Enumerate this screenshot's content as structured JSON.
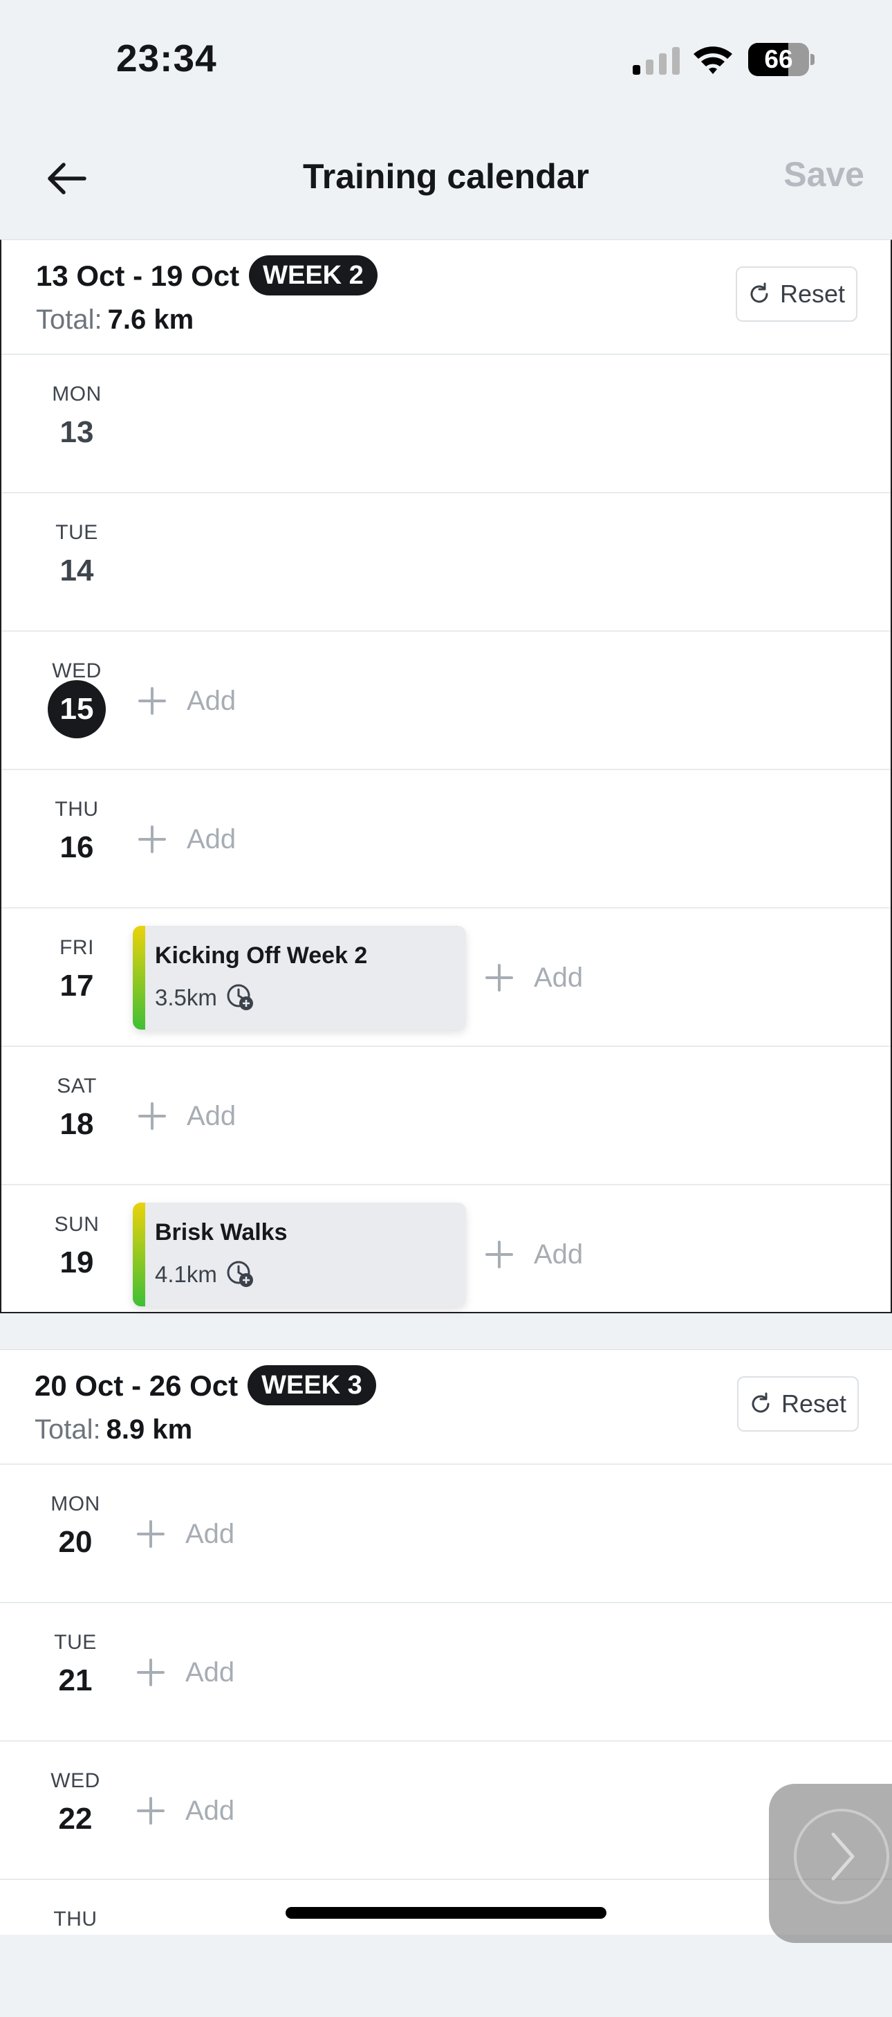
{
  "status_bar": {
    "time": "23:34",
    "battery": "66",
    "battery_level": 0.66
  },
  "nav": {
    "title": "Training calendar",
    "save_label": "Save",
    "back_icon": "arrow-left-icon"
  },
  "weeks": [
    {
      "range": "13 Oct - 19 Oct",
      "badge": "WEEK 2",
      "total_label": "Total:",
      "total_value": "7.6 km",
      "reset_label": "Reset",
      "days": [
        {
          "name": "MON",
          "num": "13"
        },
        {
          "name": "TUE",
          "num": "14"
        },
        {
          "name": "WED",
          "num": "15",
          "add": "Add"
        },
        {
          "name": "THU",
          "num": "16",
          "add": "Add"
        },
        {
          "name": "FRI",
          "num": "17",
          "add": "Add",
          "workout": {
            "title": "Kicking Off Week 2",
            "distance": "3.5km"
          }
        },
        {
          "name": "SAT",
          "num": "18",
          "add": "Add"
        },
        {
          "name": "SUN",
          "num": "19",
          "add": "Add",
          "workout": {
            "title": "Brisk Walks",
            "distance": "4.1km"
          }
        }
      ]
    },
    {
      "range": "20 Oct - 26 Oct",
      "badge": "WEEK 3",
      "total_label": "Total:",
      "total_value": "8.9 km",
      "reset_label": "Reset",
      "days": [
        {
          "name": "MON",
          "num": "20",
          "add": "Add"
        },
        {
          "name": "TUE",
          "num": "21",
          "add": "Add"
        },
        {
          "name": "WED",
          "num": "22",
          "add": "Add"
        },
        {
          "name": "THU"
        }
      ]
    }
  ],
  "colors": {
    "accent": "#17191c",
    "workout_bar_top": "#ead20c",
    "workout_bar_bottom": "#3fbf35",
    "muted": "#a7adb4"
  }
}
